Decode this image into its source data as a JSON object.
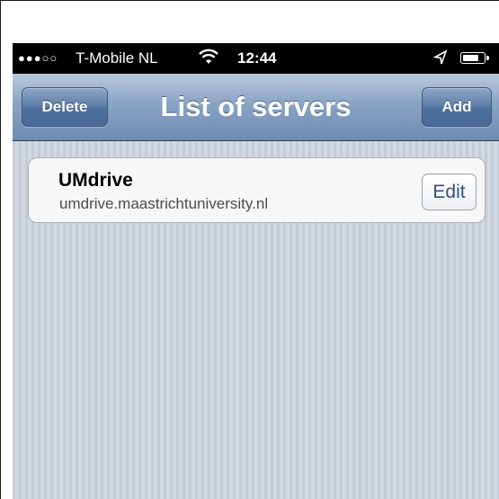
{
  "status_bar": {
    "signal": "●●●○○",
    "carrier": "T-Mobile NL",
    "time": "12:44",
    "battery_level": 0.85
  },
  "nav_bar": {
    "title": "List of servers",
    "delete_label": "Delete",
    "add_label": "Add"
  },
  "servers": [
    {
      "name": "UMdrive",
      "host": "umdrive.maastrichtuniversity.nl",
      "edit_label": "Edit"
    }
  ],
  "colors": {
    "nav_bar": "#8aa4c4",
    "nav_button": "#5c7ca6",
    "edit_text": "#344f7d",
    "status_bar": "#000000"
  }
}
